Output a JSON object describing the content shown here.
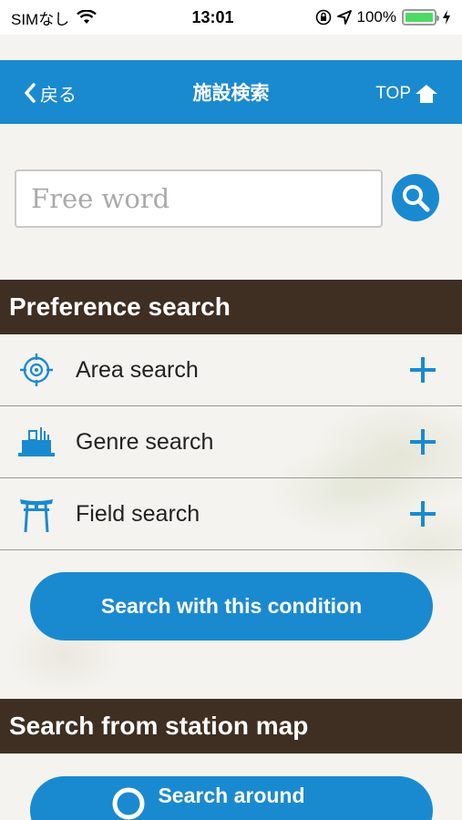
{
  "status_bar": {
    "carrier": "SIMなし",
    "time": "13:01",
    "battery_percent": "100%"
  },
  "nav": {
    "back_label": "戻る",
    "title": "施設検索",
    "top_label": "TOP"
  },
  "search": {
    "placeholder": "Free word"
  },
  "preference": {
    "header": "Preference search",
    "items": [
      {
        "label": "Area search",
        "icon": "target-icon"
      },
      {
        "label": "Genre search",
        "icon": "building-icon"
      },
      {
        "label": "Field search",
        "icon": "torii-icon"
      }
    ],
    "submit_label": "Search with this condition"
  },
  "station_map": {
    "header": "Search from station map",
    "search_around_label": "Search around"
  },
  "colors": {
    "accent": "#1a8ad0",
    "header_brown": "#3f2e22"
  }
}
